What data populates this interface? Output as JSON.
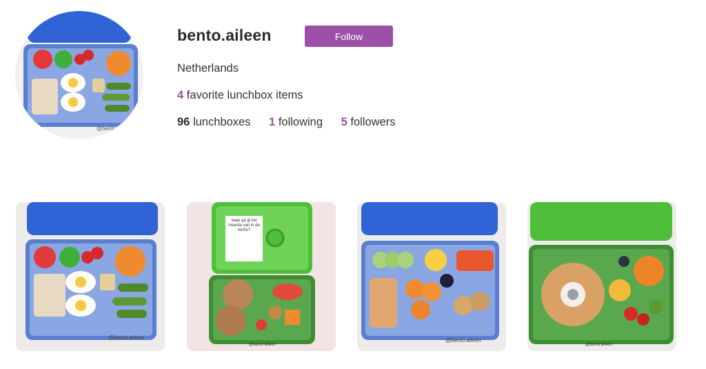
{
  "profile": {
    "username": "bento.aileen",
    "follow_label": "Follow",
    "location": "Netherlands",
    "favorites_count": "4",
    "favorites_label": "favorite lunchbox items",
    "lunchboxes_count": "96",
    "lunchboxes_label": "lunchboxes",
    "following_count": "1",
    "following_label": "following",
    "followers_count": "5",
    "followers_label": "followers",
    "watermark": "@bento.aileen"
  },
  "posts": [
    {
      "lid_color": "#2f63d6",
      "watermark": "@bento.aileen"
    },
    {
      "lid_color": "#4fbf3a",
      "watermark": "@bento.aileen",
      "card_text": "waar ga jij het meeste van in de herfst?"
    },
    {
      "lid_color": "#2f63d6",
      "watermark": "@bento.aileen"
    },
    {
      "lid_color": "#4fbf3a",
      "watermark": "@bento.aileen"
    }
  ],
  "colors": {
    "accent": "#9b4fa6",
    "blue_box": "#2f63d6",
    "green_box": "#4fbf3a"
  }
}
